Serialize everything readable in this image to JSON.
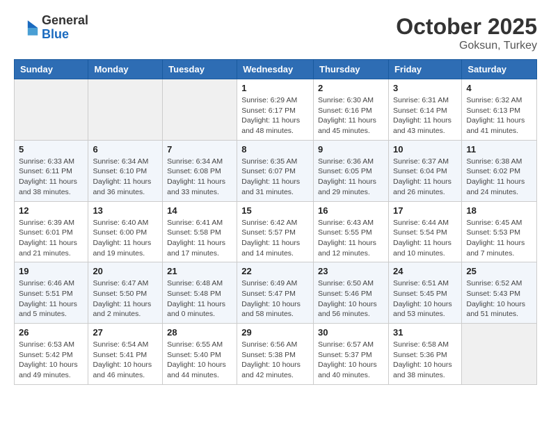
{
  "header": {
    "logo_general": "General",
    "logo_blue": "Blue",
    "month": "October 2025",
    "location": "Goksun, Turkey"
  },
  "days_of_week": [
    "Sunday",
    "Monday",
    "Tuesday",
    "Wednesday",
    "Thursday",
    "Friday",
    "Saturday"
  ],
  "weeks": [
    [
      {
        "day": "",
        "content": ""
      },
      {
        "day": "",
        "content": ""
      },
      {
        "day": "",
        "content": ""
      },
      {
        "day": "1",
        "content": "Sunrise: 6:29 AM\nSunset: 6:17 PM\nDaylight: 11 hours\nand 48 minutes."
      },
      {
        "day": "2",
        "content": "Sunrise: 6:30 AM\nSunset: 6:16 PM\nDaylight: 11 hours\nand 45 minutes."
      },
      {
        "day": "3",
        "content": "Sunrise: 6:31 AM\nSunset: 6:14 PM\nDaylight: 11 hours\nand 43 minutes."
      },
      {
        "day": "4",
        "content": "Sunrise: 6:32 AM\nSunset: 6:13 PM\nDaylight: 11 hours\nand 41 minutes."
      }
    ],
    [
      {
        "day": "5",
        "content": "Sunrise: 6:33 AM\nSunset: 6:11 PM\nDaylight: 11 hours\nand 38 minutes."
      },
      {
        "day": "6",
        "content": "Sunrise: 6:34 AM\nSunset: 6:10 PM\nDaylight: 11 hours\nand 36 minutes."
      },
      {
        "day": "7",
        "content": "Sunrise: 6:34 AM\nSunset: 6:08 PM\nDaylight: 11 hours\nand 33 minutes."
      },
      {
        "day": "8",
        "content": "Sunrise: 6:35 AM\nSunset: 6:07 PM\nDaylight: 11 hours\nand 31 minutes."
      },
      {
        "day": "9",
        "content": "Sunrise: 6:36 AM\nSunset: 6:05 PM\nDaylight: 11 hours\nand 29 minutes."
      },
      {
        "day": "10",
        "content": "Sunrise: 6:37 AM\nSunset: 6:04 PM\nDaylight: 11 hours\nand 26 minutes."
      },
      {
        "day": "11",
        "content": "Sunrise: 6:38 AM\nSunset: 6:02 PM\nDaylight: 11 hours\nand 24 minutes."
      }
    ],
    [
      {
        "day": "12",
        "content": "Sunrise: 6:39 AM\nSunset: 6:01 PM\nDaylight: 11 hours\nand 21 minutes."
      },
      {
        "day": "13",
        "content": "Sunrise: 6:40 AM\nSunset: 6:00 PM\nDaylight: 11 hours\nand 19 minutes."
      },
      {
        "day": "14",
        "content": "Sunrise: 6:41 AM\nSunset: 5:58 PM\nDaylight: 11 hours\nand 17 minutes."
      },
      {
        "day": "15",
        "content": "Sunrise: 6:42 AM\nSunset: 5:57 PM\nDaylight: 11 hours\nand 14 minutes."
      },
      {
        "day": "16",
        "content": "Sunrise: 6:43 AM\nSunset: 5:55 PM\nDaylight: 11 hours\nand 12 minutes."
      },
      {
        "day": "17",
        "content": "Sunrise: 6:44 AM\nSunset: 5:54 PM\nDaylight: 11 hours\nand 10 minutes."
      },
      {
        "day": "18",
        "content": "Sunrise: 6:45 AM\nSunset: 5:53 PM\nDaylight: 11 hours\nand 7 minutes."
      }
    ],
    [
      {
        "day": "19",
        "content": "Sunrise: 6:46 AM\nSunset: 5:51 PM\nDaylight: 11 hours\nand 5 minutes."
      },
      {
        "day": "20",
        "content": "Sunrise: 6:47 AM\nSunset: 5:50 PM\nDaylight: 11 hours\nand 2 minutes."
      },
      {
        "day": "21",
        "content": "Sunrise: 6:48 AM\nSunset: 5:48 PM\nDaylight: 11 hours\nand 0 minutes."
      },
      {
        "day": "22",
        "content": "Sunrise: 6:49 AM\nSunset: 5:47 PM\nDaylight: 10 hours\nand 58 minutes."
      },
      {
        "day": "23",
        "content": "Sunrise: 6:50 AM\nSunset: 5:46 PM\nDaylight: 10 hours\nand 56 minutes."
      },
      {
        "day": "24",
        "content": "Sunrise: 6:51 AM\nSunset: 5:45 PM\nDaylight: 10 hours\nand 53 minutes."
      },
      {
        "day": "25",
        "content": "Sunrise: 6:52 AM\nSunset: 5:43 PM\nDaylight: 10 hours\nand 51 minutes."
      }
    ],
    [
      {
        "day": "26",
        "content": "Sunrise: 6:53 AM\nSunset: 5:42 PM\nDaylight: 10 hours\nand 49 minutes."
      },
      {
        "day": "27",
        "content": "Sunrise: 6:54 AM\nSunset: 5:41 PM\nDaylight: 10 hours\nand 46 minutes."
      },
      {
        "day": "28",
        "content": "Sunrise: 6:55 AM\nSunset: 5:40 PM\nDaylight: 10 hours\nand 44 minutes."
      },
      {
        "day": "29",
        "content": "Sunrise: 6:56 AM\nSunset: 5:38 PM\nDaylight: 10 hours\nand 42 minutes."
      },
      {
        "day": "30",
        "content": "Sunrise: 6:57 AM\nSunset: 5:37 PM\nDaylight: 10 hours\nand 40 minutes."
      },
      {
        "day": "31",
        "content": "Sunrise: 6:58 AM\nSunset: 5:36 PM\nDaylight: 10 hours\nand 38 minutes."
      },
      {
        "day": "",
        "content": ""
      }
    ]
  ]
}
